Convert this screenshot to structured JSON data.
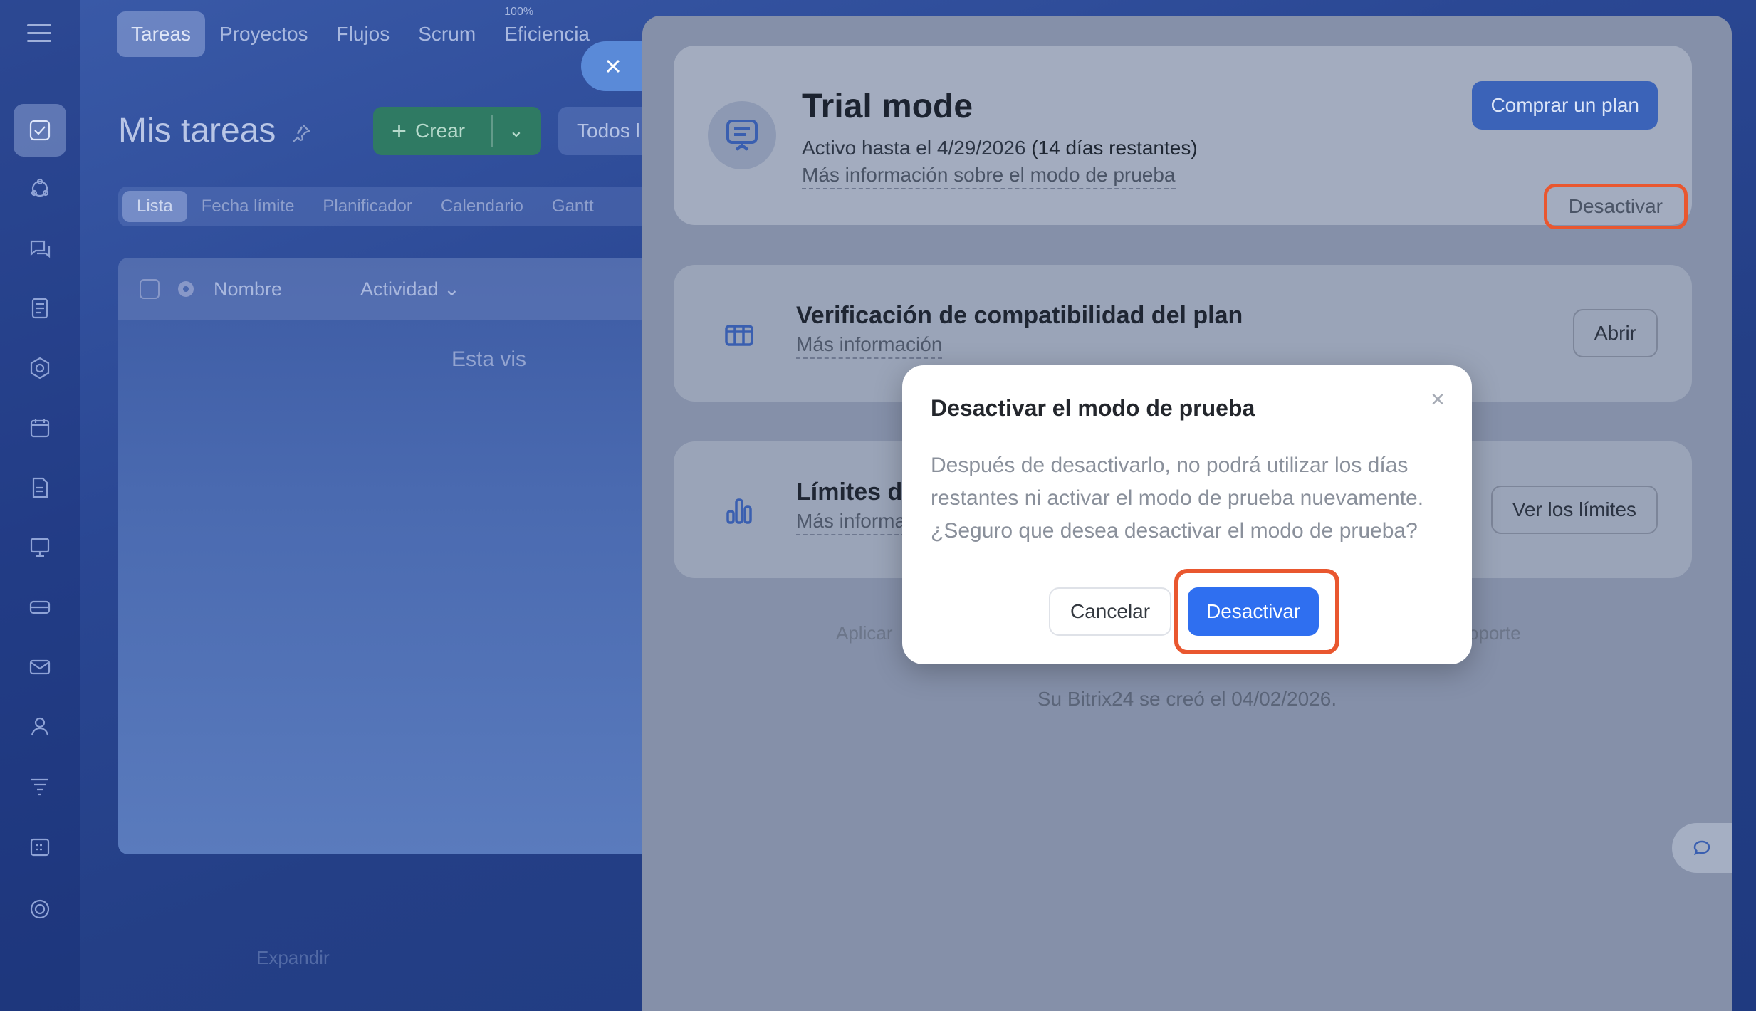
{
  "left_app": {
    "nav_tabs": [
      {
        "label": "Tareas",
        "active": true
      },
      {
        "label": "Proyectos"
      },
      {
        "label": "Flujos"
      },
      {
        "label": "Scrum"
      }
    ],
    "efficiency": {
      "label": "Eficiencia",
      "percent": "100%"
    },
    "page_title": "Mis tareas",
    "create_label": "Crear",
    "filter_label": "Todos l",
    "view_tabs": [
      "Lista",
      "Fecha límite",
      "Planificador",
      "Calendario",
      "Gantt"
    ],
    "table": {
      "col_name": "Nombre",
      "col_activity": "Actividad",
      "empty_text": "Esta vis"
    },
    "footer_faded": "Expandir"
  },
  "panel": {
    "trial": {
      "title": "Trial mode",
      "active_until": "Activo hasta el 4/29/2026",
      "days_left": "(14 días restantes)",
      "more_info": "Más información sobre el modo de prueba",
      "buy_label": "Comprar un plan",
      "deactivate_label": "Desactivar"
    },
    "verification": {
      "title": "Verificación de compatibilidad del plan",
      "more_info": "Más información",
      "button": "Abrir"
    },
    "limits": {
      "title": "Límites d",
      "more_info": "Más informa",
      "button": "Ver los límites"
    },
    "footer_left": "Aplicar",
    "footer_right": "oporte",
    "created_text": "Su Bitrix24 se creó el 04/02/2026."
  },
  "modal": {
    "title": "Desactivar el modo de prueba",
    "body": "Después de desactivarlo, no podrá utilizar los días restantes ni activar el modo de prueba nuevamente. ¿Seguro que desea desactivar el modo de prueba?",
    "cancel_label": "Cancelar",
    "confirm_label": "Desactivar"
  },
  "colors": {
    "accent_blue": "#2f6ff0",
    "highlight_ring": "#e9572f",
    "create_green": "#2f7a63"
  }
}
